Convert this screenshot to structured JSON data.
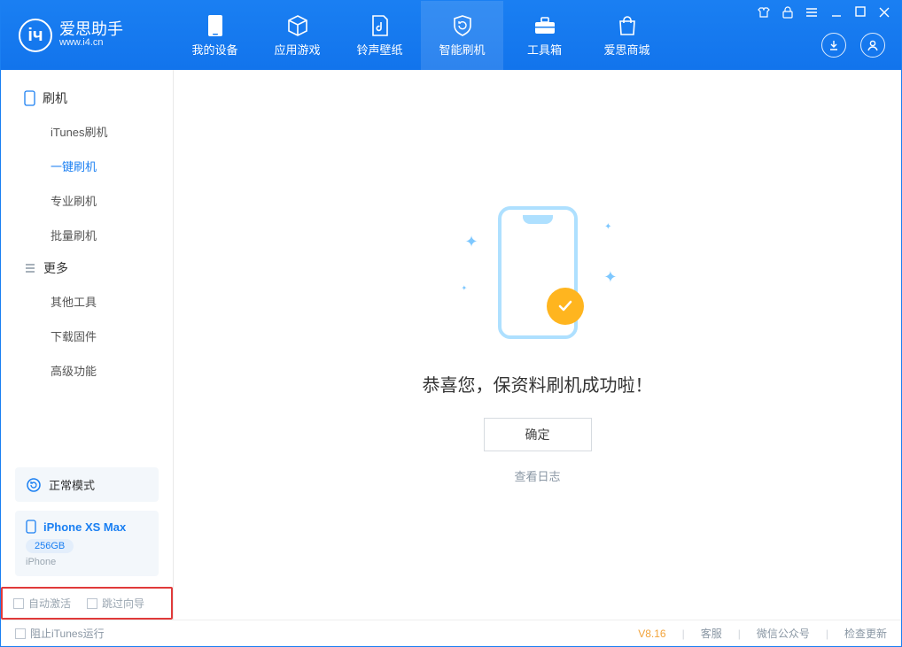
{
  "app": {
    "name_cn": "爱思助手",
    "site": "www.i4.cn"
  },
  "top_tabs": [
    {
      "label": "我的设备"
    },
    {
      "label": "应用游戏"
    },
    {
      "label": "铃声壁纸"
    },
    {
      "label": "智能刷机"
    },
    {
      "label": "工具箱"
    },
    {
      "label": "爱思商城"
    }
  ],
  "sidebar": {
    "group1": {
      "title": "刷机",
      "items": [
        "iTunes刷机",
        "一键刷机",
        "专业刷机",
        "批量刷机"
      ]
    },
    "group2": {
      "title": "更多",
      "items": [
        "其他工具",
        "下载固件",
        "高级功能"
      ]
    }
  },
  "status_box": {
    "label": "正常模式"
  },
  "device": {
    "name": "iPhone XS Max",
    "storage": "256GB",
    "type": "iPhone"
  },
  "side_checks": {
    "c1": "自动激活",
    "c2": "跳过向导"
  },
  "main": {
    "success_text": "恭喜您，保资料刷机成功啦！",
    "ok_button": "确定",
    "log_link": "查看日志"
  },
  "statusbar": {
    "stop_itunes": "阻止iTunes运行",
    "version": "V8.16",
    "links": [
      "客服",
      "微信公众号",
      "检查更新"
    ]
  }
}
